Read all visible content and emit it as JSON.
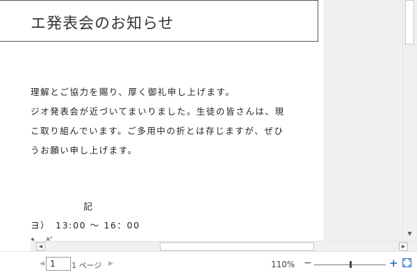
{
  "document": {
    "title": "エ発表会のお知らせ",
    "body_lines": [
      "理解とご協力を賜り、厚く御礼申し上げます。",
      "ジオ発表会が近づいてまいりました。生徒の皆さんは、現",
      "こ取り組んでいます。ご多用中の折とは存じますが、ぜひ",
      "うお願い申し上げます。"
    ],
    "ki": "記",
    "time_line": "ヨ）　13:00 ～ 16：00",
    "cut_line": "ｶ　ｸﾞ"
  },
  "status": {
    "page_input": "1",
    "page_total": "1 ページ",
    "zoom_level": "110%",
    "zoom_minus": "−",
    "zoom_plus": "+",
    "zoom_fraction": 0.5
  },
  "icons": {
    "prev": "prev-page-icon",
    "next": "next-page-icon",
    "fit": "fit-page-icon"
  }
}
